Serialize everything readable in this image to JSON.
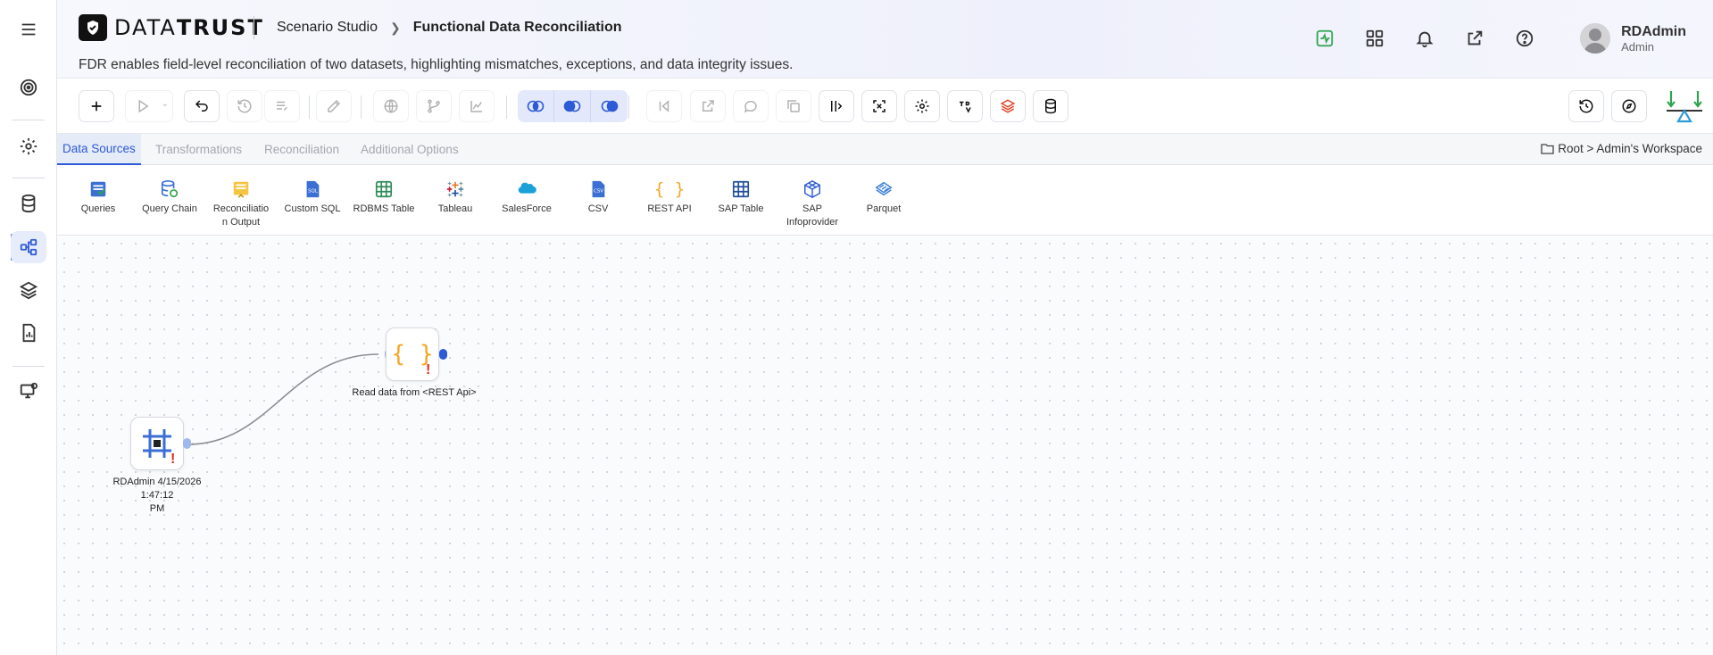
{
  "app": {
    "brand_left": "DATA",
    "brand_right": "TRUST",
    "breadcrumb_parent": "Scenario Studio",
    "breadcrumb_current": "Functional Data Reconciliation",
    "description": "FDR enables field-level reconciliation of two datasets, highlighting mismatches, exceptions, and data integrity issues."
  },
  "user": {
    "name": "RDAdmin",
    "role": "Admin"
  },
  "tabs": [
    {
      "label": "Data Sources",
      "active": true
    },
    {
      "label": "Transformations",
      "active": false
    },
    {
      "label": "Reconciliation",
      "active": false
    },
    {
      "label": "Additional Options",
      "active": false
    }
  ],
  "workspace_path": "Root > Admin's Workspace",
  "sources": [
    {
      "label": "Queries",
      "icon": "queries-icon"
    },
    {
      "label": "Query Chain",
      "icon": "query-chain-icon"
    },
    {
      "label": "Reconciliation Output",
      "line1": "Reconciliatio",
      "line2": "n Output",
      "icon": "reconciliation-output-icon"
    },
    {
      "label": "Custom SQL",
      "icon": "custom-sql-icon"
    },
    {
      "label": "RDBMS Table",
      "icon": "rdbms-table-icon"
    },
    {
      "label": "Tableau",
      "icon": "tableau-icon"
    },
    {
      "label": "SalesForce",
      "icon": "salesforce-icon"
    },
    {
      "label": "CSV",
      "icon": "csv-icon"
    },
    {
      "label": "REST API",
      "icon": "rest-api-icon"
    },
    {
      "label": "SAP Table",
      "icon": "sap-table-icon"
    },
    {
      "label": "SAP Infoprovider",
      "line1": "SAP",
      "line2": "Infoprovider",
      "icon": "sap-infoprovider-icon"
    },
    {
      "label": "Parquet",
      "icon": "parquet-icon"
    }
  ],
  "canvas": {
    "nodes": [
      {
        "label_line1": "RDAdmin 4/15/2026 1:47:12",
        "label_line2": "PM",
        "icon": "grid-node-icon",
        "warning": "!"
      },
      {
        "label": "Read data from <REST Api>",
        "icon": "rest-api-node-icon",
        "warning": "!"
      }
    ]
  },
  "colors": {
    "accent": "#2d5bd7",
    "warning": "#e12a1c",
    "rest_api": "#f5a623",
    "green": "#2ea44f"
  }
}
